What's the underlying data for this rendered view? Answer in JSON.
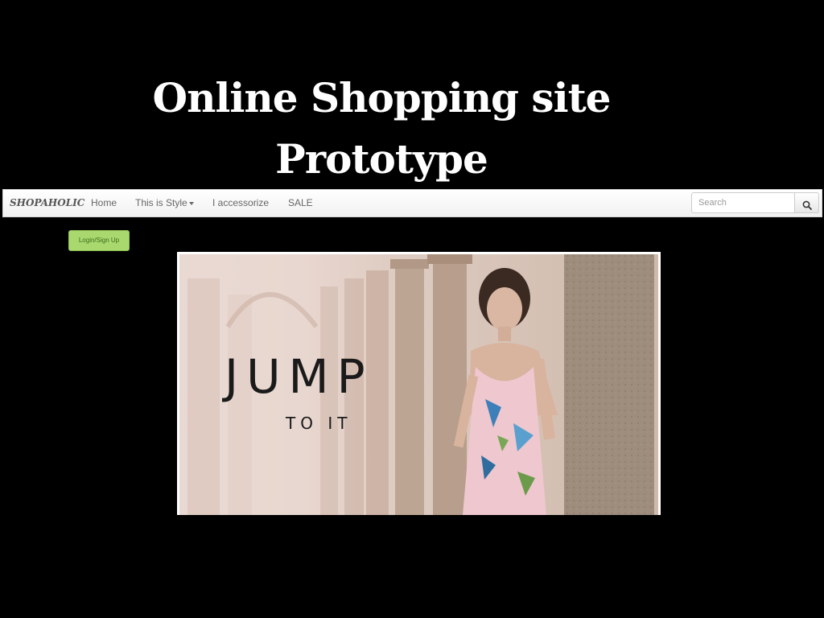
{
  "slide": {
    "title_line1": "Online Shopping site",
    "title_line2": "Prototype"
  },
  "navbar": {
    "brand": "SHOPAHOLIC",
    "items": [
      {
        "label": "Home"
      },
      {
        "label": "This is Style",
        "has_dropdown": true
      },
      {
        "label": "I accessorize"
      },
      {
        "label": "SALE"
      }
    ],
    "search": {
      "placeholder": "Search",
      "icon": "search-icon"
    }
  },
  "login": {
    "label": "Login/Sign Up",
    "color": "#a9d86e"
  },
  "banner": {
    "headline": "JUMP",
    "subline": "TO IT"
  }
}
